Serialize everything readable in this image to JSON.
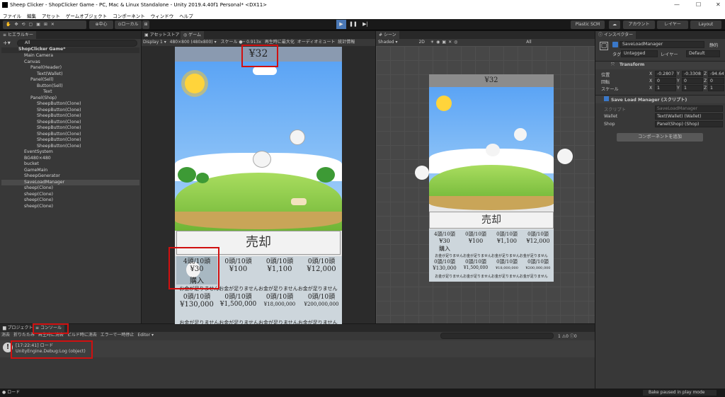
{
  "window": {
    "title": "Sheep Clicker - ShopClicker Game - PC, Mac & Linux Standalone - Unity 2019.4.40f1 Personal* <DX11>",
    "minimize": "—",
    "maximize": "☐",
    "close": "✕"
  },
  "menu": [
    "ファイル",
    "編集",
    "アセット",
    "ゲームオブジェクト",
    "コンポーネント",
    "ウィンドウ",
    "ヘルプ"
  ],
  "toolbar": {
    "center": "中心",
    "local": "ローカル",
    "plastic": "Plastic SCM",
    "account": "アカウント",
    "layers": "レイヤー",
    "layout": "Layout"
  },
  "hierarchy": {
    "tab": "ヒエラルキー",
    "search": "All",
    "items": [
      "ShopClicker Game*",
      "Main Camera",
      "Canvas",
      "Panel(Header)",
      "Text(Wallet)",
      "Panel(Sell)",
      "Button(Sell)",
      "Text",
      "Panel(Shop)",
      "SheepButton(Clone)",
      "SheepButton(Clone)",
      "SheepButton(Clone)",
      "SheepButton(Clone)",
      "SheepButton(Clone)",
      "SheepButton(Clone)",
      "SheepButton(Clone)",
      "SheepButton(Clone)",
      "EventSystem",
      "BG480×480",
      "bucket",
      "GameMain",
      "SheepGenerator",
      "SaveLoadManager",
      "sheep(Clone)",
      "sheep(Clone)",
      "sheep(Clone)",
      "sheep(Clone)"
    ]
  },
  "game": {
    "tab_asset": "アセットストア",
    "tab_game": "ゲーム",
    "display": "Display 1",
    "resolution": "480×800 (480x800)",
    "scale_label": "スケール",
    "scale_value": "0.913x",
    "maximize": "再生時に最大化",
    "mute": "オーディオミュート",
    "stats": "統計情報",
    "wallet": "¥32",
    "sell": "売却",
    "shop": [
      [
        "4頭/10頭",
        "¥30",
        "購入"
      ],
      [
        "0頭/10頭",
        "¥100",
        ""
      ],
      [
        "0頭/10頭",
        "¥1,100",
        ""
      ],
      [
        "0頭/10頭",
        "¥12,000",
        ""
      ],
      [
        "0頭/10頭",
        "¥130,000",
        ""
      ],
      [
        "0頭/10頭",
        "¥1,500,000",
        ""
      ],
      [
        "0頭/10頭",
        "¥18,000,000",
        ""
      ],
      [
        "0頭/10頭",
        "¥200,000,000",
        ""
      ]
    ],
    "no_money": "お金が足りません"
  },
  "scene": {
    "tab": "シーン",
    "shaded": "Shaded",
    "mode2d": "2D",
    "search": "All",
    "wallet": "¥32",
    "sell": "売却",
    "shop": [
      [
        "4頭/10頭",
        "¥30",
        "購入"
      ],
      [
        "0頭/10頭",
        "¥100",
        ""
      ],
      [
        "0頭/10頭",
        "¥1,100",
        ""
      ],
      [
        "0頭/10頭",
        "¥12,000",
        ""
      ],
      [
        "0頭/10頭",
        "¥130,000",
        ""
      ],
      [
        "0頭/10頭",
        "¥1,500,000",
        ""
      ],
      [
        "0頭/10頭",
        "¥18,000,000",
        ""
      ],
      [
        "0頭/10頭",
        "¥200,000,000",
        ""
      ]
    ],
    "no_money": "お金が足りません"
  },
  "inspector": {
    "tab": "インスペクター",
    "name": "SaveLoadManager",
    "static": "静的",
    "tag_label": "タグ",
    "tag": "Untagged",
    "layer_label": "レイヤー",
    "layer": "Default",
    "transform": "Transform",
    "pos_label": "位置",
    "pos": [
      "-0.2807",
      "-0.3308",
      "-94.646"
    ],
    "rot_label": "回転",
    "rot": [
      "0",
      "0",
      "0"
    ],
    "scale_label": "スケール",
    "scale": [
      "1",
      "1",
      "1"
    ],
    "component": "Save Load Manager (スクリプト)",
    "script_label": "スクリプト",
    "script": "SaveLoadManager",
    "wallet_label": "Wallet",
    "wallet": "Text(Wallet) (Wallet)",
    "shop_label": "Shop",
    "shop": "Panel(Shop) (Shop)",
    "add": "コンポーネントを追加"
  },
  "console": {
    "tab_project": "プロジェクト",
    "tab_console": "コンソール",
    "buttons": [
      "消去",
      "折りたたみ",
      "再生時に消去",
      "ビルド時に消去",
      "エラーで一時停止",
      "Editor ▾"
    ],
    "log_time": "[17:22:41] ロード",
    "log_detail": "UnityEngine.Debug:Log (object)",
    "count_err": "1",
    "count_warn": "0",
    "count_info": "0"
  },
  "status": {
    "left": "ロード",
    "right": "Bake paused in play mode"
  }
}
